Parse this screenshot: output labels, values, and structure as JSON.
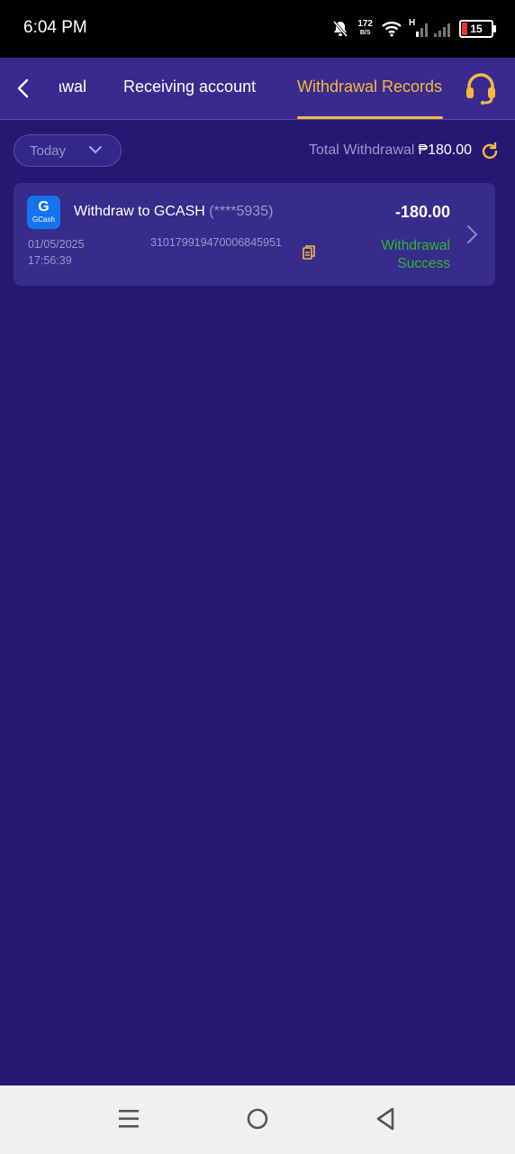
{
  "status_bar": {
    "time": "6:04 PM",
    "net_speed_value": "172",
    "net_speed_unit": "B/S",
    "network_type": "H",
    "battery_level": "15"
  },
  "header": {
    "tabs": [
      {
        "label": "Withdrawal"
      },
      {
        "label": "Receiving account"
      },
      {
        "label": "Withdrawal Records"
      }
    ],
    "active_tab_index": 2,
    "accent_color": "#f5b83d"
  },
  "filter": {
    "date_selected": "Today",
    "total_label": "Total Withdrawal",
    "total_value": "₱180.00"
  },
  "records": [
    {
      "method_logo_text": "G",
      "method_logo_subtext": "GCash",
      "title": "Withdraw to GCASH",
      "masked_account": "(****5935)",
      "amount": "-180.00",
      "date": "01/05/2025",
      "time": "17:56:39",
      "order_no": "310179919470006845951",
      "status_line1": "Withdrawal",
      "status_line2": "Success",
      "status_color": "#2db52d"
    }
  ],
  "colors": {
    "background": "#261872",
    "header_bg": "#3a2a8f",
    "card_bg": "#372b8c",
    "muted_text": "#9d95c8"
  },
  "icons": {
    "back": "chevron-left-icon",
    "support": "headset-icon",
    "refresh": "refresh-icon",
    "copy": "copy-icon",
    "record_chevron": "chevron-right-icon",
    "filter_chevron": "chevron-down-icon"
  }
}
